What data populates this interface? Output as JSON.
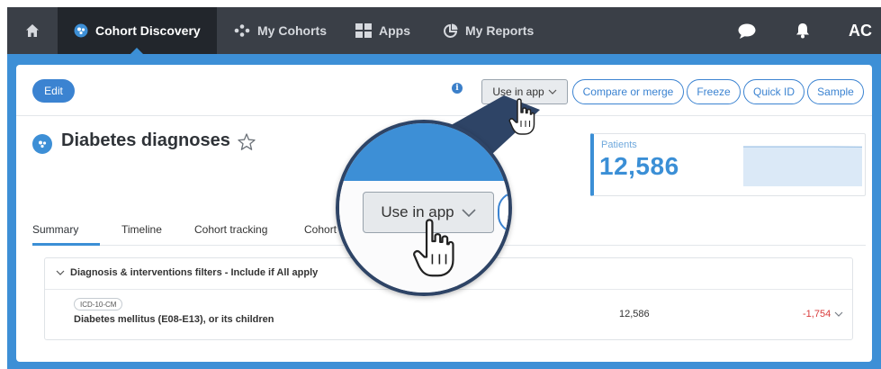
{
  "nav": {
    "home_icon": "home-icon",
    "items": [
      {
        "label": "Cohort Discovery",
        "icon": "cohort-icon",
        "active": true
      },
      {
        "label": "My Cohorts",
        "icon": "nodes-icon",
        "active": false
      },
      {
        "label": "Apps",
        "icon": "grid-icon",
        "active": false
      },
      {
        "label": "My Reports",
        "icon": "pie-chart-icon",
        "active": false
      }
    ],
    "right": {
      "chat_icon": "chat-icon",
      "bell_icon": "bell-icon",
      "user_initials": "AC"
    }
  },
  "toolbar": {
    "edit_label": "Edit",
    "info_glyph": "i",
    "use_in_app_label": "Use in app",
    "compare_label": "Compare or merge",
    "freeze_label": "Freeze",
    "quick_id_label": "Quick ID",
    "sample_label": "Sample"
  },
  "cohort": {
    "title": "Diabetes diagnoses",
    "star_icon": "star-outline-icon"
  },
  "stat": {
    "label": "Patients",
    "value": "12,586",
    "sparkline": [
      12586,
      12586,
      12586,
      12586,
      12520
    ]
  },
  "tabs": [
    {
      "label": "Summary",
      "active": true
    },
    {
      "label": "Timeline",
      "active": false
    },
    {
      "label": "Cohort tracking",
      "active": false
    },
    {
      "label": "Cohort",
      "active": false
    }
  ],
  "filter": {
    "heading": "Diagnosis & interventions filters - Include if All apply",
    "code_badge": "ICD-10-CM",
    "label": "Diabetes mellitus (E08-E13), or its children",
    "count": "12,586",
    "delta": "-1,754"
  },
  "zoom": {
    "button_label": "Use in app"
  },
  "colors": {
    "nav_bg": "#3a3f47",
    "accent": "#3d8fd6",
    "negative": "#d93b3b"
  }
}
